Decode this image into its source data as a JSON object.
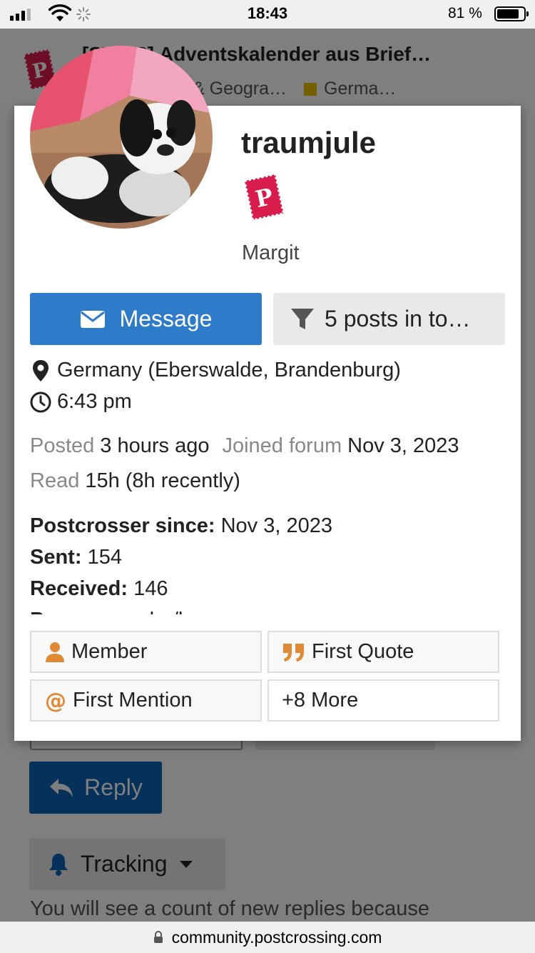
{
  "status_bar": {
    "time": "18:43",
    "battery_percent": "81 %"
  },
  "background_page": {
    "topic_title": "[SWAP] Adventskalender aus Brief…",
    "categories": [
      "& Geogra…",
      "Germa…"
    ],
    "category_colors": [
      "#e6c200"
    ],
    "reply_label": "Reply",
    "tracking_label": "Tracking",
    "tracking_note": "You will see a count of new replies because"
  },
  "user_card": {
    "username": "traumjule",
    "real_name": "Margit",
    "message_label": "Message",
    "posts_filter_label": "5 posts in to…",
    "location": "Germany (Eberswalde, Brandenburg)",
    "local_time": "6:43 pm",
    "posted_label": "Posted",
    "posted_value": "3 hours ago",
    "joined_label": "Joined forum",
    "joined_value": "Nov 3, 2023",
    "read_label": "Read",
    "read_value": "15h (8h recently)",
    "fields": [
      {
        "label": "Postcrosser since:",
        "value": "Nov 3, 2023"
      },
      {
        "label": "Sent:",
        "value": "154"
      },
      {
        "label": "Received:",
        "value": "146"
      },
      {
        "label": "Pronouns:",
        "value": "she/her"
      }
    ],
    "badges": [
      {
        "label": "Member",
        "icon": "user-icon"
      },
      {
        "label": "First Quote",
        "icon": "quote-icon"
      },
      {
        "label": "First Mention",
        "icon": "at-icon"
      },
      {
        "label": "+8 More",
        "icon": ""
      }
    ],
    "colors": {
      "primary": "#2d7bc9",
      "badge_icon": "#e08a35",
      "flair": "#d81c4b"
    }
  },
  "url_bar": {
    "url": "community.postcrossing.com"
  }
}
